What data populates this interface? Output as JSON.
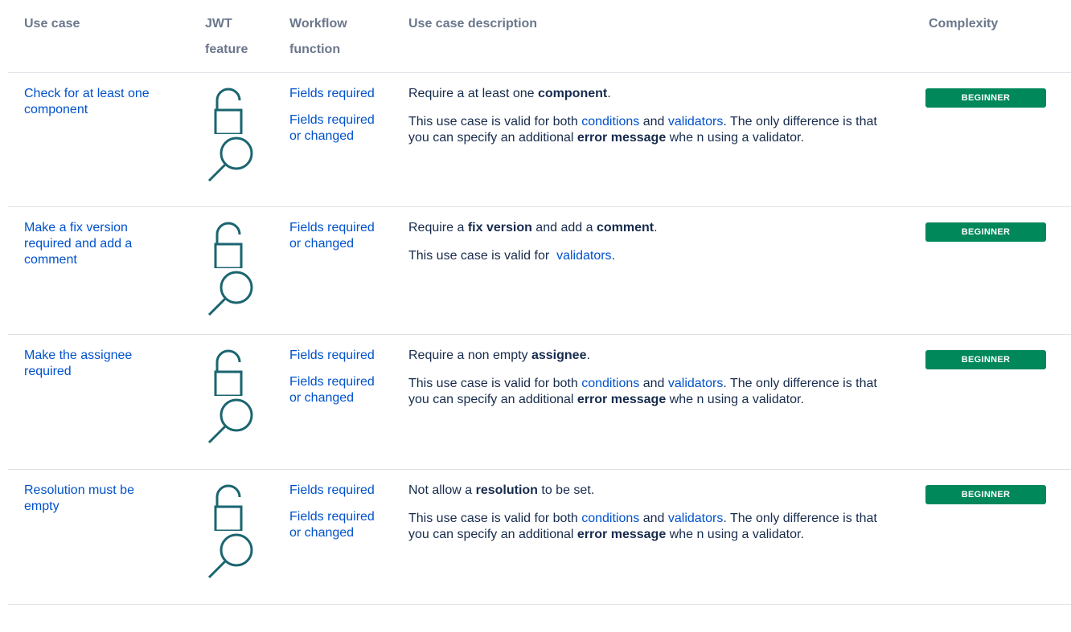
{
  "headers": {
    "use_case": "Use case",
    "jwt_feature_1": "JWT",
    "jwt_feature_2": "feature",
    "workflow_function_1": "Workflow",
    "workflow_function_2": "function",
    "description": "Use case description",
    "complexity": "Complexity"
  },
  "rows": [
    {
      "use_case": "Check for at least one component",
      "workflow_functions": [
        "Fields required",
        "Fields required or changed"
      ],
      "desc1_pre": "Require a at least one ",
      "desc1_bold": "component",
      "desc1_post": ".",
      "desc2_pre": "This use case is valid for both ",
      "desc2_link1": "conditions",
      "desc2_mid": " and ",
      "desc2_link2": "validators",
      "desc2_post": ". The only difference is that you can specify an additional ",
      "desc2_bold": "error message",
      "desc2_end": " whe n using a validator.",
      "complexity": "BEGINNER"
    },
    {
      "use_case": "Make a fix version required and add a comment",
      "workflow_functions": [
        "Fields required or changed"
      ],
      "desc1_pre": "Require a ",
      "desc1_bold": "fix version",
      "desc1_mid": " and add a ",
      "desc1_bold2": "comment",
      "desc1_post": ".",
      "desc2_pre": "This use case is valid for  ",
      "desc2_link": "validators",
      "desc2_post": ".",
      "complexity": "BEGINNER"
    },
    {
      "use_case": "Make the assignee required",
      "workflow_functions": [
        "Fields required",
        "Fields required or changed"
      ],
      "desc1_pre": "Require a non empty ",
      "desc1_bold": "assignee",
      "desc1_post": ".",
      "desc2_pre": "This use case is valid for both ",
      "desc2_link1": "conditions",
      "desc2_mid": " and ",
      "desc2_link2": "validators",
      "desc2_post": ". The only difference is that you can specify an additional ",
      "desc2_bold": "error message",
      "desc2_end": " whe n using a validator.",
      "complexity": "BEGINNER"
    },
    {
      "use_case": "Resolution must be empty",
      "workflow_functions": [
        "Fields required",
        "Fields required or changed"
      ],
      "desc1_pre": "Not allow a ",
      "desc1_bold": "resolution",
      "desc1_post": " to be set.",
      "desc2_pre": "This use case is valid for both ",
      "desc2_link1": "conditions",
      "desc2_mid": " and ",
      "desc2_link2": "validators",
      "desc2_post": ". The only difference is that you can specify an additional ",
      "desc2_bold": "error message",
      "desc2_end": " whe n using a validator.",
      "complexity": "BEGINNER"
    }
  ],
  "colors": {
    "link": "#0052cc",
    "badge": "#00875a",
    "icon": "#1a6570",
    "header": "#6b778c"
  },
  "icons": [
    "padlock-open-icon",
    "magnifier-icon"
  ]
}
